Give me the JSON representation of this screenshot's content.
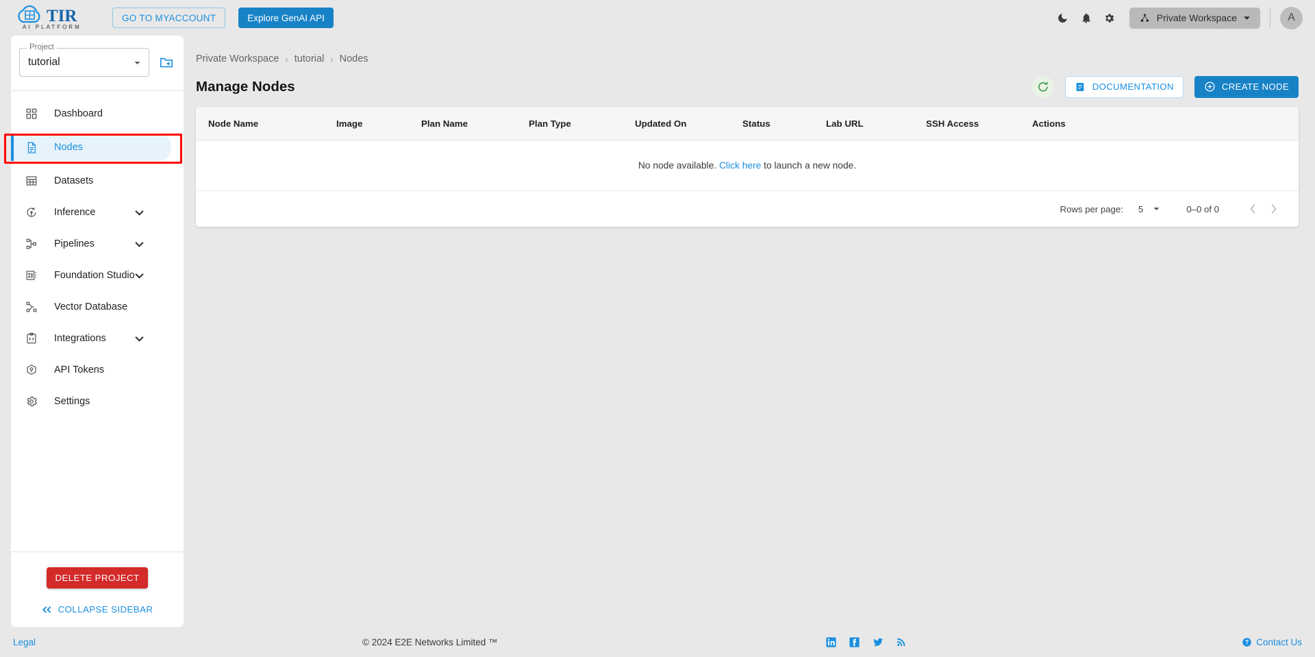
{
  "topbar": {
    "logo_text": "TIR",
    "logo_subtext": "AI PLATFORM",
    "myaccount_label": "GO TO MYACCOUNT",
    "genai_label": "Explore GenAI API",
    "dark_mode_icon": "moon-icon",
    "notifications_icon": "bell-icon",
    "settings_icon": "gear-icon",
    "workspace_label": "Private Workspace",
    "workspace_icon": "workspace-icon",
    "avatar_initial": "A"
  },
  "sidebar": {
    "project_legend": "Project",
    "project_value": "tutorial",
    "new_project_icon": "create-new-folder-icon",
    "items": [
      {
        "label": "Dashboard",
        "icon": "dashboard-icon",
        "expandable": false,
        "active": false
      },
      {
        "label": "Nodes",
        "icon": "document-icon",
        "expandable": false,
        "active": true
      },
      {
        "label": "Datasets",
        "icon": "datasets-grid-icon",
        "expandable": false,
        "active": false
      },
      {
        "label": "Inference",
        "icon": "inference-icon",
        "expandable": true,
        "active": false
      },
      {
        "label": "Pipelines",
        "icon": "pipelines-icon",
        "expandable": true,
        "active": false
      },
      {
        "label": "Foundation Studio",
        "icon": "foundation-studio-icon",
        "expandable": true,
        "active": false
      },
      {
        "label": "Vector Database",
        "icon": "vector-database-icon",
        "expandable": false,
        "active": false
      },
      {
        "label": "Integrations",
        "icon": "integrations-icon",
        "expandable": true,
        "active": false
      },
      {
        "label": "API Tokens",
        "icon": "api-tokens-icon",
        "expandable": false,
        "active": false
      },
      {
        "label": "Settings",
        "icon": "settings-gear-icon",
        "expandable": false,
        "active": false
      }
    ],
    "delete_project_label": "DELETE PROJECT",
    "collapse_label": "COLLAPSE SIDEBAR",
    "collapse_icon": "double-chevron-left-icon"
  },
  "breadcrumb": {
    "items": [
      "Private Workspace",
      "tutorial",
      "Nodes"
    ],
    "separator": "›"
  },
  "header": {
    "title": "Manage Nodes",
    "refresh_icon": "refresh-icon",
    "documentation_label": "DOCUMENTATION",
    "documentation_icon": "book-icon",
    "create_node_label": "CREATE NODE",
    "create_node_icon": "plus-circle-icon"
  },
  "table": {
    "columns": [
      "Node Name",
      "Image",
      "Plan Name",
      "Plan Type",
      "Updated On",
      "Status",
      "Lab URL",
      "SSH Access",
      "Actions"
    ],
    "rows": [],
    "empty_prefix": "No node available. ",
    "empty_link": "Click here",
    "empty_suffix": " to launch a new node."
  },
  "pagination": {
    "rows_per_page_label": "Rows per page:",
    "rows_per_page_value": "5",
    "range_label": "0–0 of 0",
    "prev_icon": "chevron-left-icon",
    "next_icon": "chevron-right-icon"
  },
  "footer": {
    "legal": "Legal",
    "copyright": "© 2024 E2E Networks Limited ™",
    "social": [
      "linkedin-icon",
      "facebook-icon",
      "twitter-icon",
      "rss-icon"
    ],
    "contact_label": "Contact Us",
    "contact_icon": "help-icon"
  },
  "colors": {
    "accent_blue": "#1a8fe0",
    "brand_blue": "#1782c6",
    "danger_red": "#d32a2a",
    "highlight_red": "#ff0000",
    "active_bg": "#e7f3fb",
    "page_bg": "#e8e8e8"
  }
}
